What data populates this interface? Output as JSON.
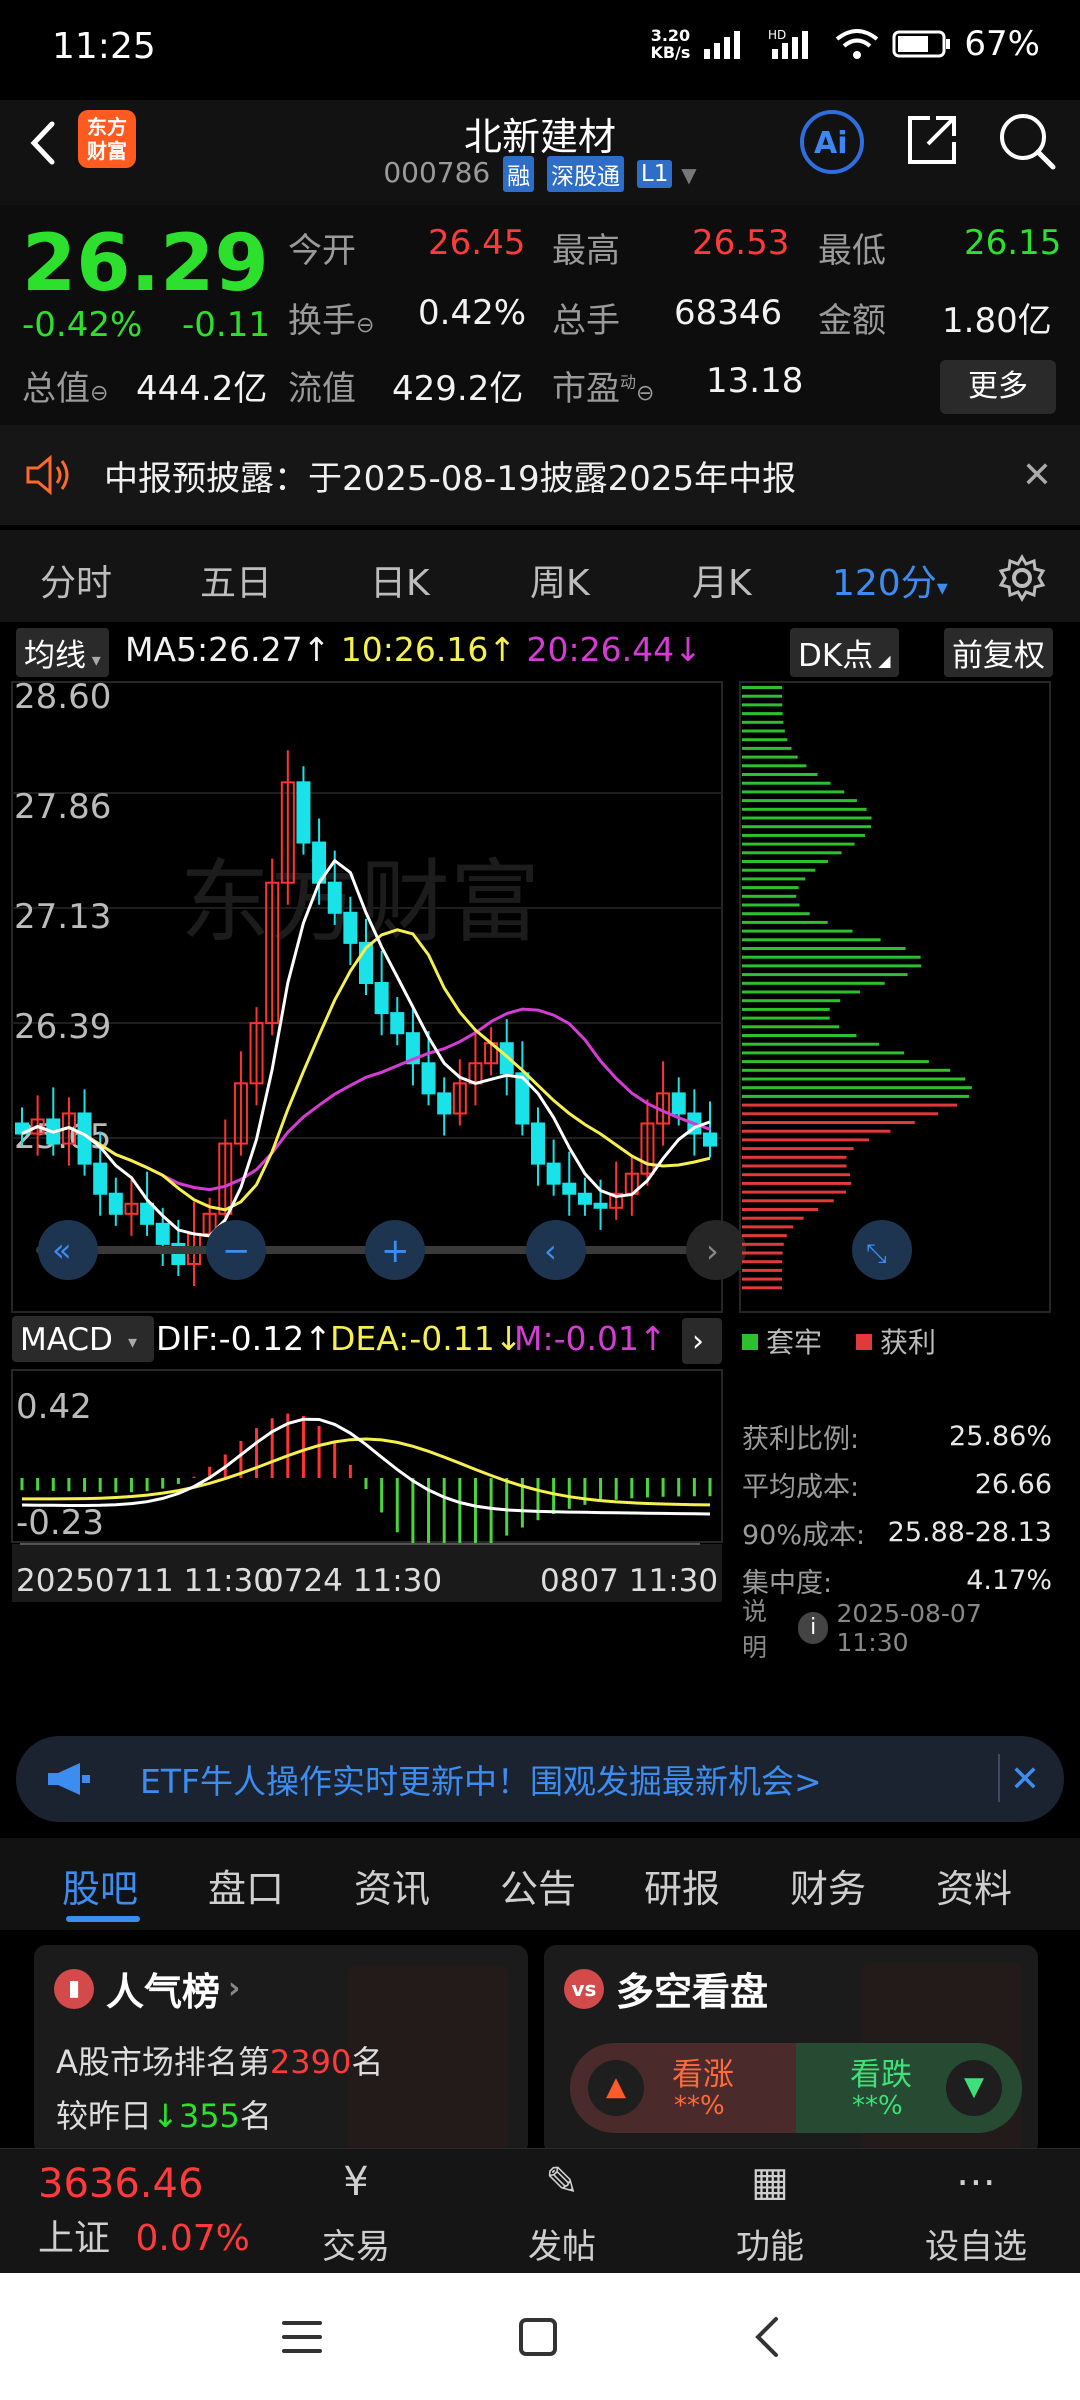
{
  "status": {
    "time": "11:25",
    "net_speed": "3.20",
    "net_unit": "KB/s",
    "signal1": "HD",
    "battery": "67%"
  },
  "header": {
    "logo_text_top": "东方",
    "logo_text_bottom": "财富",
    "title": "北新建材",
    "code": "000786",
    "tags": [
      "融",
      "深股通",
      "L1"
    ]
  },
  "quote": {
    "price": "26.29",
    "change_pct": "-0.42%",
    "change": "-0.11",
    "open_label": "今开",
    "open": "26.45",
    "high_label": "最高",
    "high": "26.53",
    "low_label": "最低",
    "low": "26.15",
    "turnover_label": "换手",
    "turnover": "0.42%",
    "volume_label": "总手",
    "volume": "68346",
    "amount_label": "金额",
    "amount": "1.80亿",
    "mktcap_label": "总值",
    "mktcap": "444.2亿",
    "float_label": "流值",
    "float": "429.2亿",
    "pe_label": "市盈",
    "pe_sup": "动",
    "pe": "13.18",
    "more": "更多"
  },
  "notice": {
    "text": "中报预披露：于2025-08-19披露2025年中报"
  },
  "ktabs": {
    "items": [
      "分时",
      "五日",
      "日K",
      "周K",
      "月K"
    ],
    "active": "120分",
    "active_arrow": "▾"
  },
  "chart": {
    "ma_selector": "均线",
    "ma5": "MA5:26.27↑",
    "ma10": "10:26.16↑",
    "ma20": "20:26.44↓",
    "dk_button": "DK点",
    "adjust_button": "前复权",
    "watermark": "东方财富",
    "y_labels": [
      "28.60",
      "27.86",
      "27.13",
      "26.39",
      "25.65"
    ],
    "macd_selector": "MACD",
    "dif": "DIF:-0.12↑",
    "dea": "DEA:-0.11↓",
    "m": "M:-0.01↑",
    "macd_y": [
      "0.42",
      "-0.23"
    ],
    "x_labels": [
      "20250711 11:30",
      "0724 11:30",
      "0807 11:30"
    ],
    "colors": {
      "up": "#ff3333",
      "down": "#19e3e8",
      "ma5": "#ffffff",
      "ma10": "#f5f050",
      "ma20": "#d43cd4"
    }
  },
  "chip_panel": {
    "legend_trap": "套牢",
    "legend_profit": "获利",
    "rows": [
      {
        "label": "获利比例:",
        "value": "25.86%"
      },
      {
        "label": "平均成本:",
        "value": "26.66"
      },
      {
        "label": "90%成本:",
        "value": "25.88-28.13"
      },
      {
        "label": "集中度:",
        "value": "4.17%"
      }
    ],
    "note_label": "说明",
    "note_time": "2025-08-07 11:30"
  },
  "etf_banner": {
    "text": "ETF牛人操作实时更新中！围观发掘最新机会>"
  },
  "bottom_tabs": {
    "items": [
      "股吧",
      "盘口",
      "资讯",
      "公告",
      "研报",
      "财务",
      "资料"
    ],
    "active_index": 0
  },
  "popularity_card": {
    "title": "人气榜",
    "line1_pre": "A股市场排名第",
    "line1_num": "2390",
    "line1_post": "名",
    "line2_pre": "较昨日",
    "line2_num": "355",
    "line2_post": "名"
  },
  "vs_card": {
    "title": "多空看盘",
    "up_label": "看涨",
    "up_value": "**%",
    "down_label": "看跌",
    "down_value": "**%"
  },
  "bottom_nav": {
    "index_value": "3636.46",
    "index_name": "上证",
    "index_change": "0.07%",
    "items": [
      "交易",
      "发帖",
      "功能",
      "设自选"
    ]
  }
}
